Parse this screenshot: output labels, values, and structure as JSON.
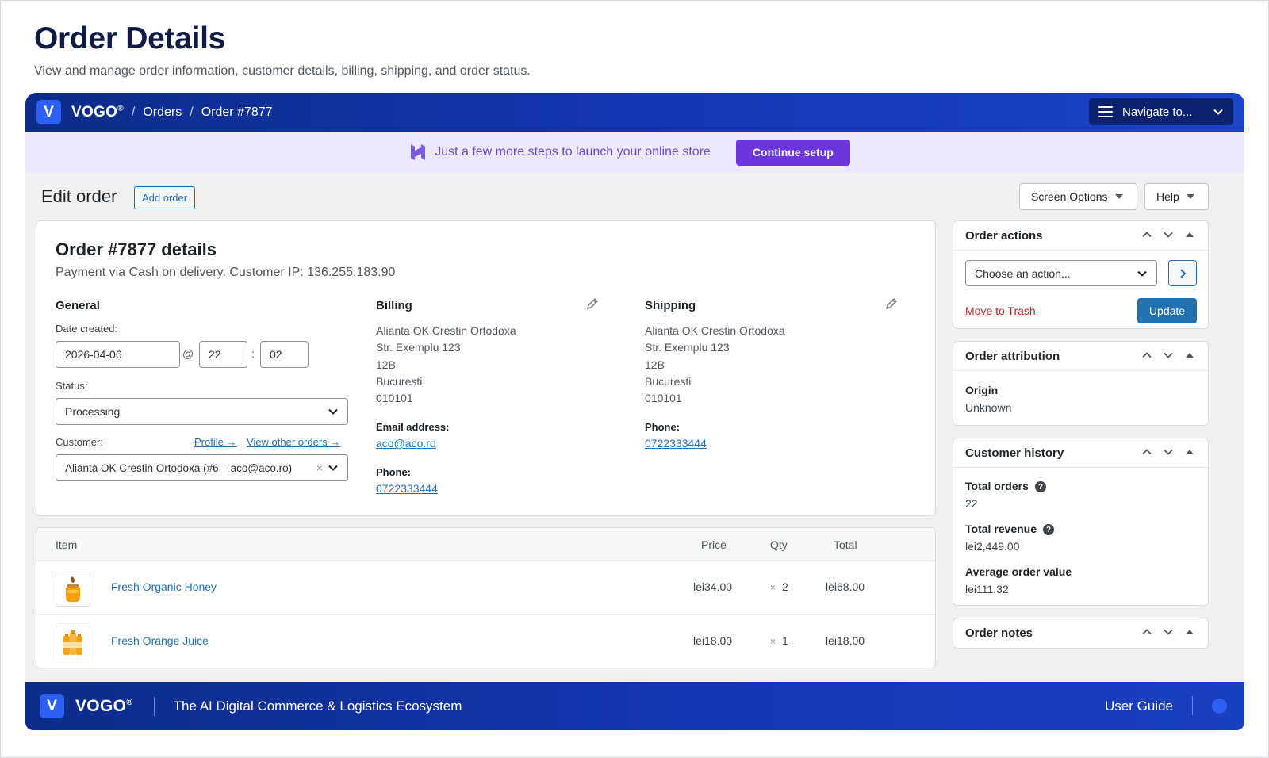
{
  "page": {
    "title": "Order Details",
    "subtitle": "View and manage order information, customer details, billing, shipping, and order status."
  },
  "topbar": {
    "logo_letter": "V",
    "brand": "VOGO",
    "brand_mark": "®",
    "breadcrumb": [
      "Orders",
      "Order #7877"
    ],
    "navigate_label": "Navigate to..."
  },
  "promo": {
    "text": "Just a few more steps to launch your online store",
    "button": "Continue setup"
  },
  "toolbar": {
    "edit_title": "Edit order",
    "add_order": "Add order",
    "screen_options": "Screen Options",
    "help": "Help"
  },
  "order": {
    "title": "Order #7877 details",
    "subtitle": "Payment via Cash on delivery. Customer IP: 136.255.183.90",
    "general": {
      "heading": "General",
      "date_label": "Date created:",
      "date": "2026-04-06",
      "at": "@",
      "hour": "22",
      "colon": ":",
      "minute": "02",
      "status_label": "Status:",
      "status": "Processing",
      "customer_label": "Customer:",
      "profile_link": "Profile →",
      "other_orders_link": "View other orders →",
      "customer": "Alianta OK Crestin Ortodoxa (#6 – aco@aco.ro)",
      "clear": "×"
    },
    "billing": {
      "heading": "Billing",
      "address": [
        "Alianta OK Crestin Ortodoxa",
        "Str. Exemplu 123",
        "12B",
        "Bucuresti",
        "010101"
      ],
      "email_label": "Email address:",
      "email": "aco@aco.ro",
      "phone_label": "Phone:",
      "phone": "0722333444"
    },
    "shipping": {
      "heading": "Shipping",
      "address": [
        "Alianta OK Crestin Ortodoxa",
        "Str. Exemplu 123",
        "12B",
        "Bucuresti",
        "010101"
      ],
      "phone_label": "Phone:",
      "phone": "0722333444"
    }
  },
  "items": {
    "headers": {
      "item": "Item",
      "price": "Price",
      "qty": "Qty",
      "total": "Total"
    },
    "rows": [
      {
        "name": "Fresh Organic Honey",
        "price": "lei34.00",
        "x": "×",
        "qty": "2",
        "total": "lei68.00",
        "icon": "honey-jar-icon"
      },
      {
        "name": "Fresh Orange Juice",
        "price": "lei18.00",
        "x": "×",
        "qty": "1",
        "total": "lei18.00",
        "icon": "juice-bottles-icon"
      }
    ]
  },
  "sidebar": {
    "order_actions": {
      "title": "Order actions",
      "select": "Choose an action...",
      "trash": "Move to Trash",
      "update": "Update"
    },
    "attribution": {
      "title": "Order attribution",
      "origin_label": "Origin",
      "origin": "Unknown"
    },
    "history": {
      "title": "Customer history",
      "total_orders_label": "Total orders",
      "total_orders": "22",
      "total_revenue_label": "Total revenue",
      "total_revenue": "lei2,449.00",
      "aov_label": "Average order value",
      "aov": "lei111.32",
      "help_glyph": "?"
    },
    "notes": {
      "title": "Order notes"
    }
  },
  "footer": {
    "logo_letter": "V",
    "brand": "VOGO",
    "brand_mark": "®",
    "tagline": "The AI Digital Commerce & Logistics Ecosystem",
    "user_guide": "User Guide"
  },
  "colors": {
    "brand_blue": "#1537b5",
    "accent_purple": "#6c35de",
    "link": "#2271b1",
    "danger": "#b32d2e"
  }
}
